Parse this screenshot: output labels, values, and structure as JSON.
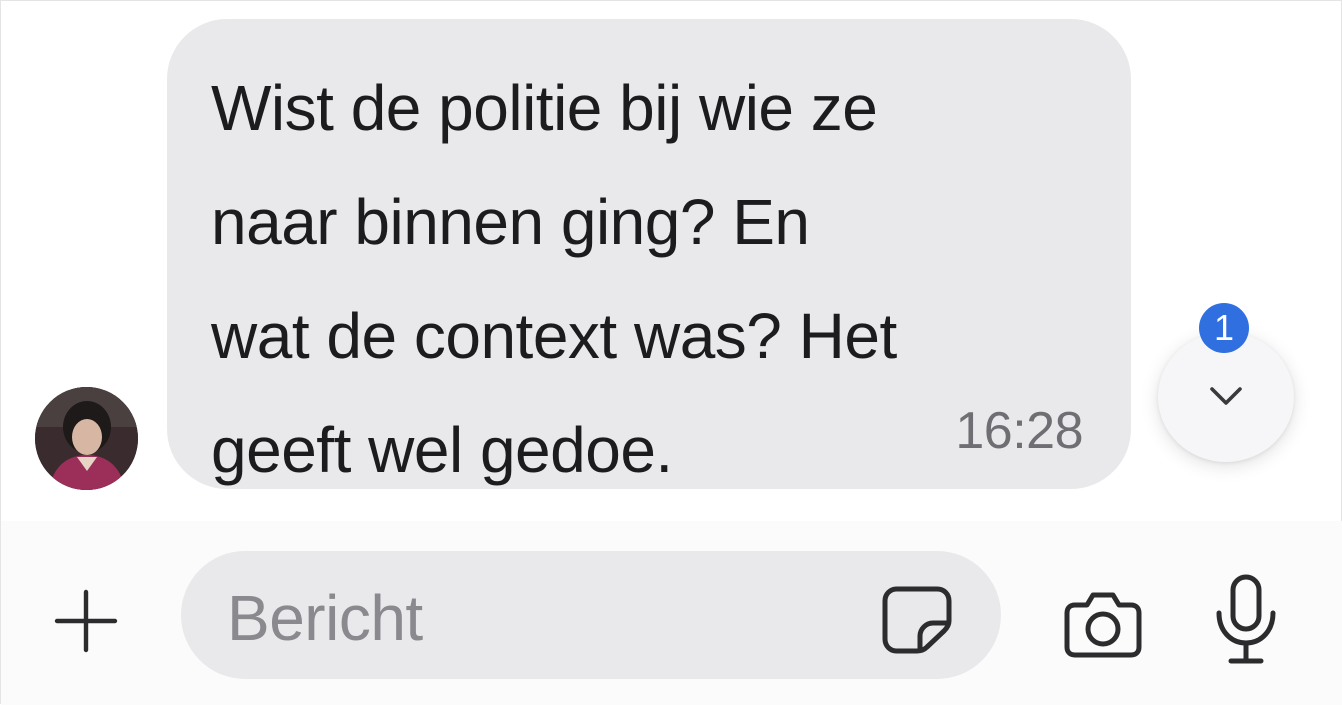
{
  "message": {
    "text": "Wist de politie bij wie ze\nnaar binnen ging? En\nwat de context was? Het\ngeeft wel gedoe.",
    "time": "16:28"
  },
  "scroll_down": {
    "unread_count": "1",
    "icon": "chevron-down-icon",
    "badge_color": "#2f6fe0"
  },
  "composer": {
    "placeholder": "Bericht",
    "icons": [
      "plus-icon",
      "sticker-icon",
      "camera-icon",
      "microphone-icon"
    ]
  },
  "colors": {
    "bubble": "#e9e9eb",
    "text": "#1c1c1e",
    "muted": "#6f6f73"
  }
}
